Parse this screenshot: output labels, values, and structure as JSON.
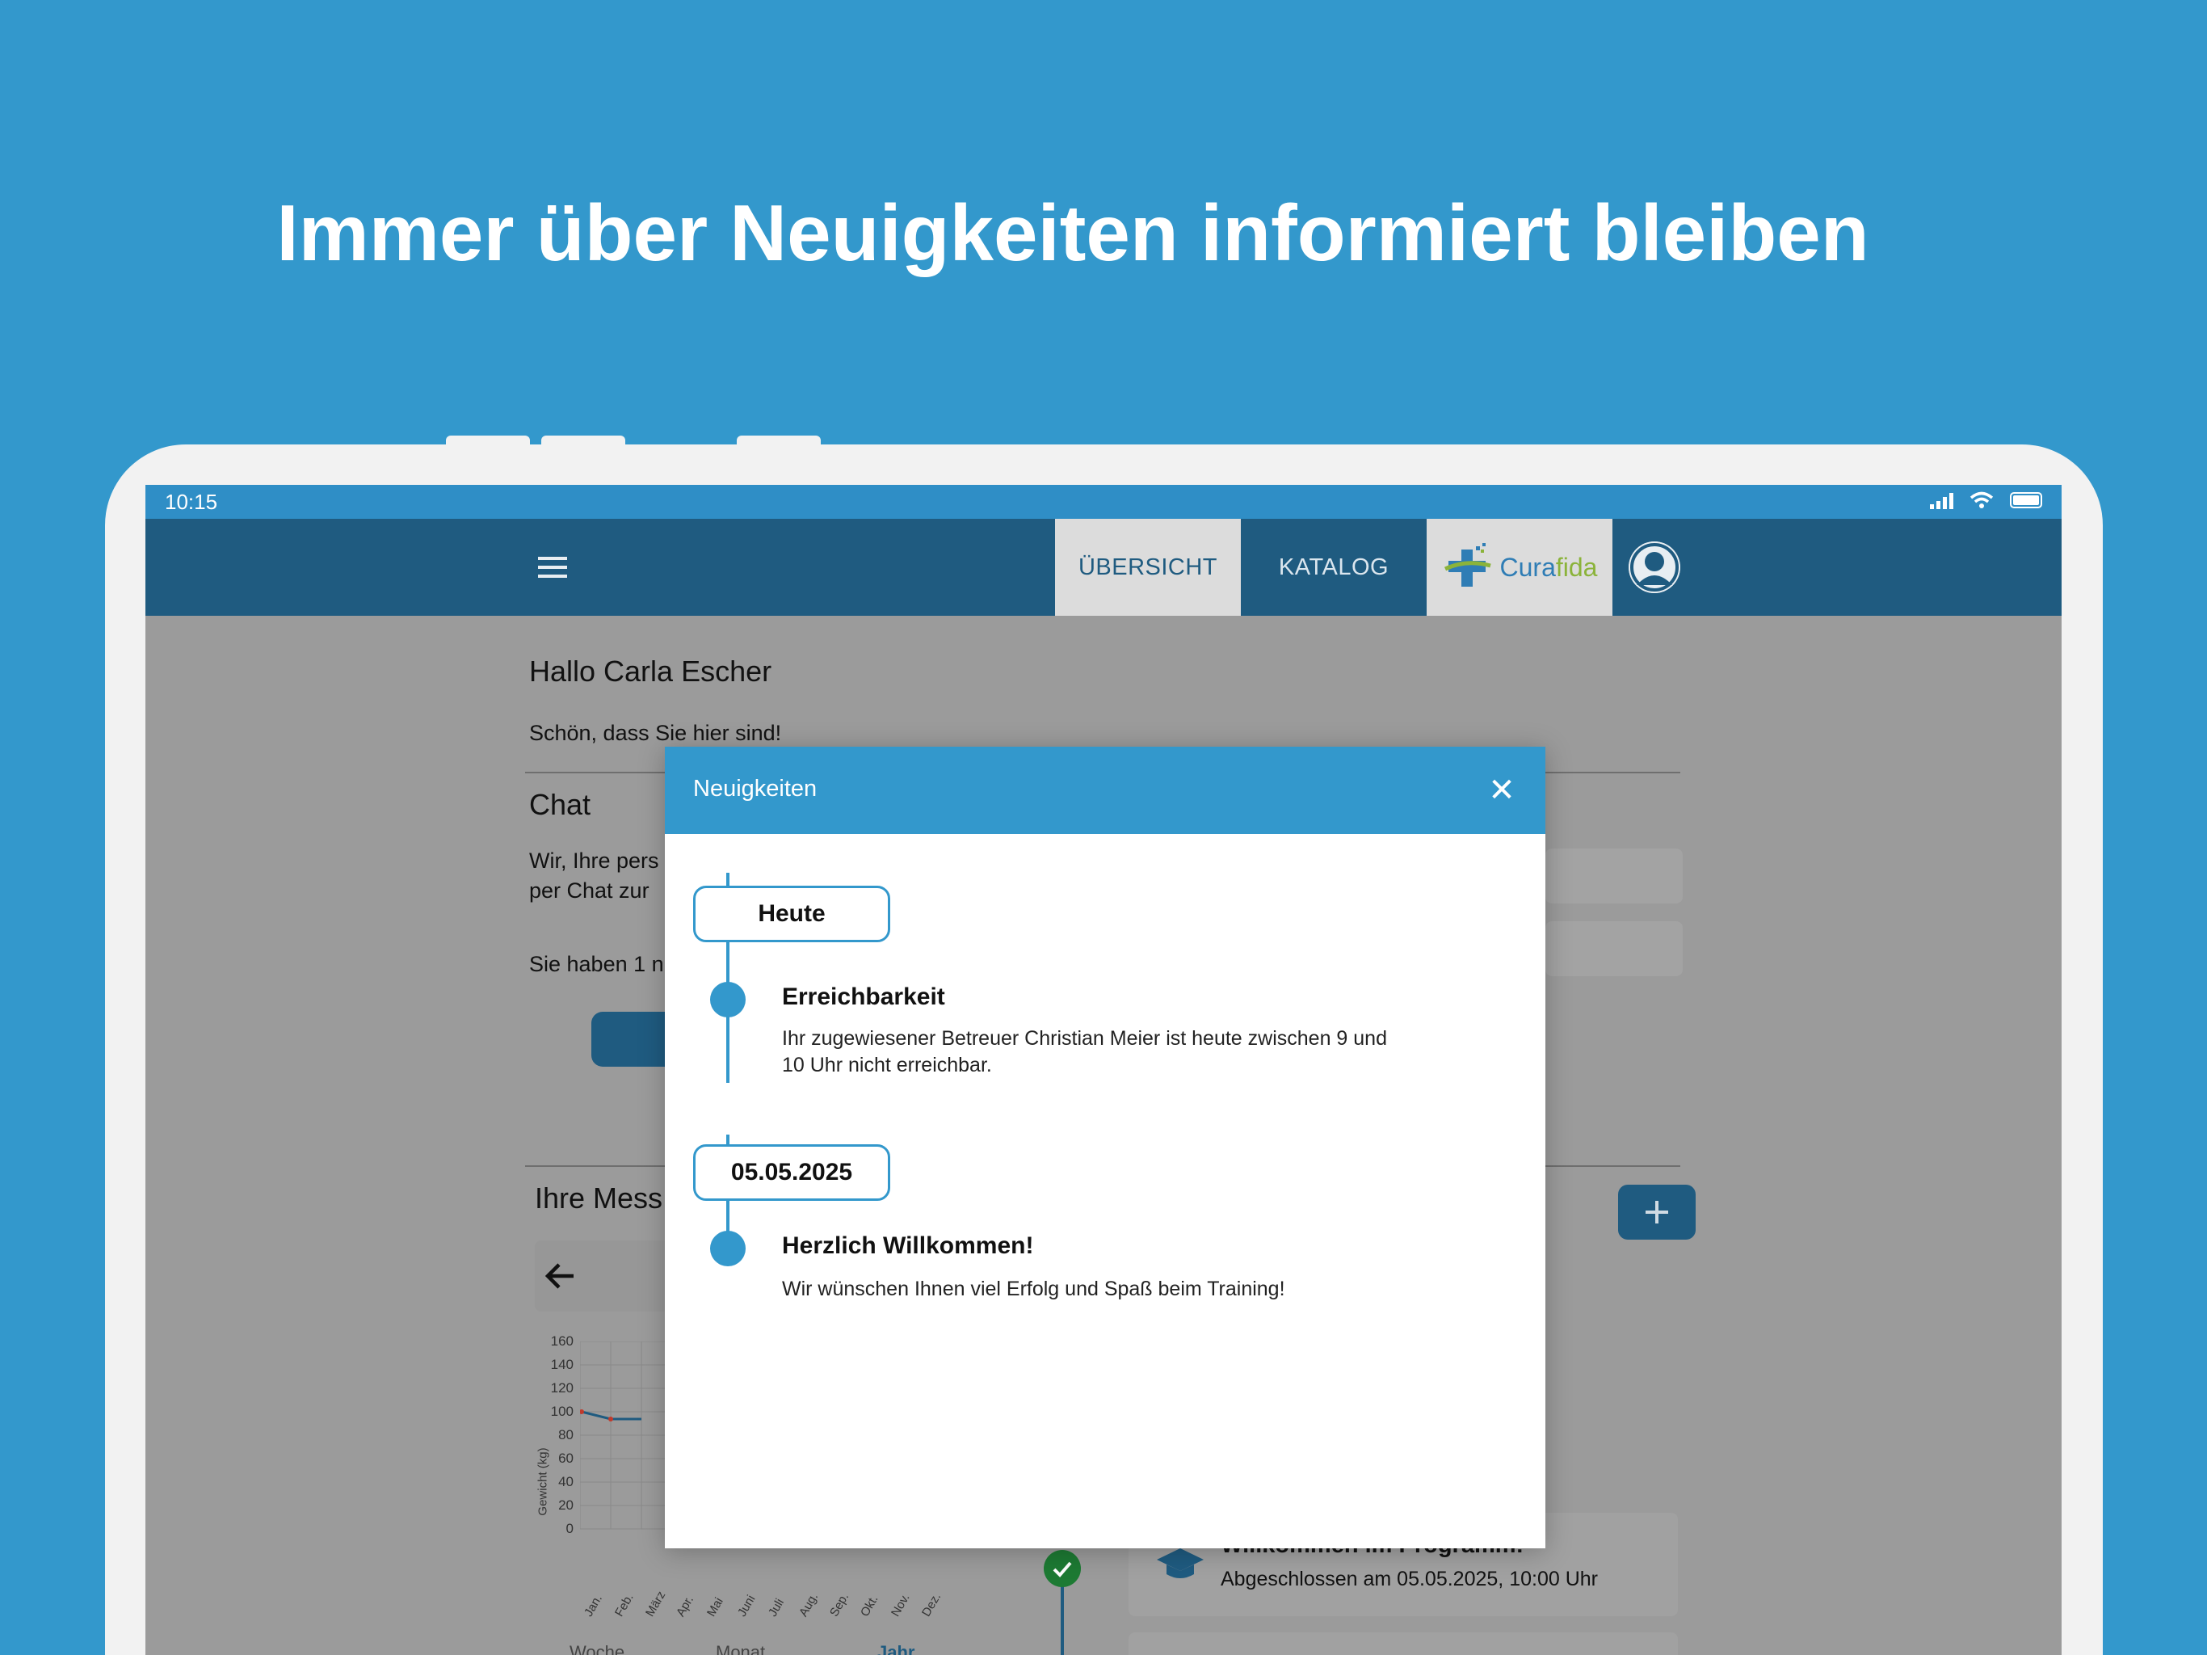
{
  "headline": "Immer über Neuigkeiten informiert bleiben",
  "status_bar": {
    "time": "10:15"
  },
  "nav": {
    "tabs": [
      {
        "label": "ÜBERSICHT",
        "active": true
      },
      {
        "label": "KATALOG",
        "active": false
      }
    ],
    "brand": {
      "part1": "Cura",
      "part2": "fida"
    }
  },
  "background_page": {
    "greeting": "Hallo Carla Escher",
    "subtitle": "Schön, dass Sie hier sind!",
    "chat_heading": "Chat",
    "chat_line1": "Wir, Ihre pers",
    "chat_line2": "per Chat zur",
    "chat_line3": "Sie haben 1 n",
    "measurements_heading": "Ihre Mess",
    "chart": {
      "ylabel": "Gewicht (kg)",
      "yticks": [
        "160",
        "140",
        "120",
        "100",
        "80",
        "60",
        "40",
        "20",
        "0"
      ],
      "xticks": [
        "Jan.",
        "Feb.",
        "März",
        "Apr.",
        "Mai",
        "Juni",
        "Juli",
        "Aug.",
        "Sep.",
        "Okt.",
        "Nov.",
        "Dez."
      ]
    },
    "card_title": "Willkommen im Programm!",
    "card_subtitle": "Abgeschlossen am 05.05.2025, 10:00 Uhr",
    "period_tabs": [
      "Woche",
      "Monat",
      "Jahr"
    ]
  },
  "modal": {
    "title": "Neuigkeiten",
    "close_glyph": "✕",
    "groups": [
      {
        "date": "Heute",
        "entries": [
          {
            "title": "Erreichbarkeit",
            "body_line1": "Ihr zugewiesener Betreuer Christian Meier ist heute zwischen 9 und",
            "body_line2": "10 Uhr nicht erreichbar."
          }
        ]
      },
      {
        "date": "05.05.2025",
        "entries": [
          {
            "title": "Herzlich Willkommen!",
            "body_line1": "Wir wünschen Ihnen viel Erfolg und Spaß beim Training!"
          }
        ]
      }
    ]
  },
  "colors": {
    "accent": "#3398cc",
    "nav": "#1f5b80",
    "overlay": "#9b9b9b",
    "brand_green": "#8bb33a"
  },
  "icons": [
    "menu-icon",
    "user-avatar-icon",
    "close-icon",
    "back-arrow-icon",
    "plus-icon",
    "check-icon",
    "graduation-cap-icon",
    "signal-icon",
    "wifi-icon",
    "battery-icon"
  ]
}
